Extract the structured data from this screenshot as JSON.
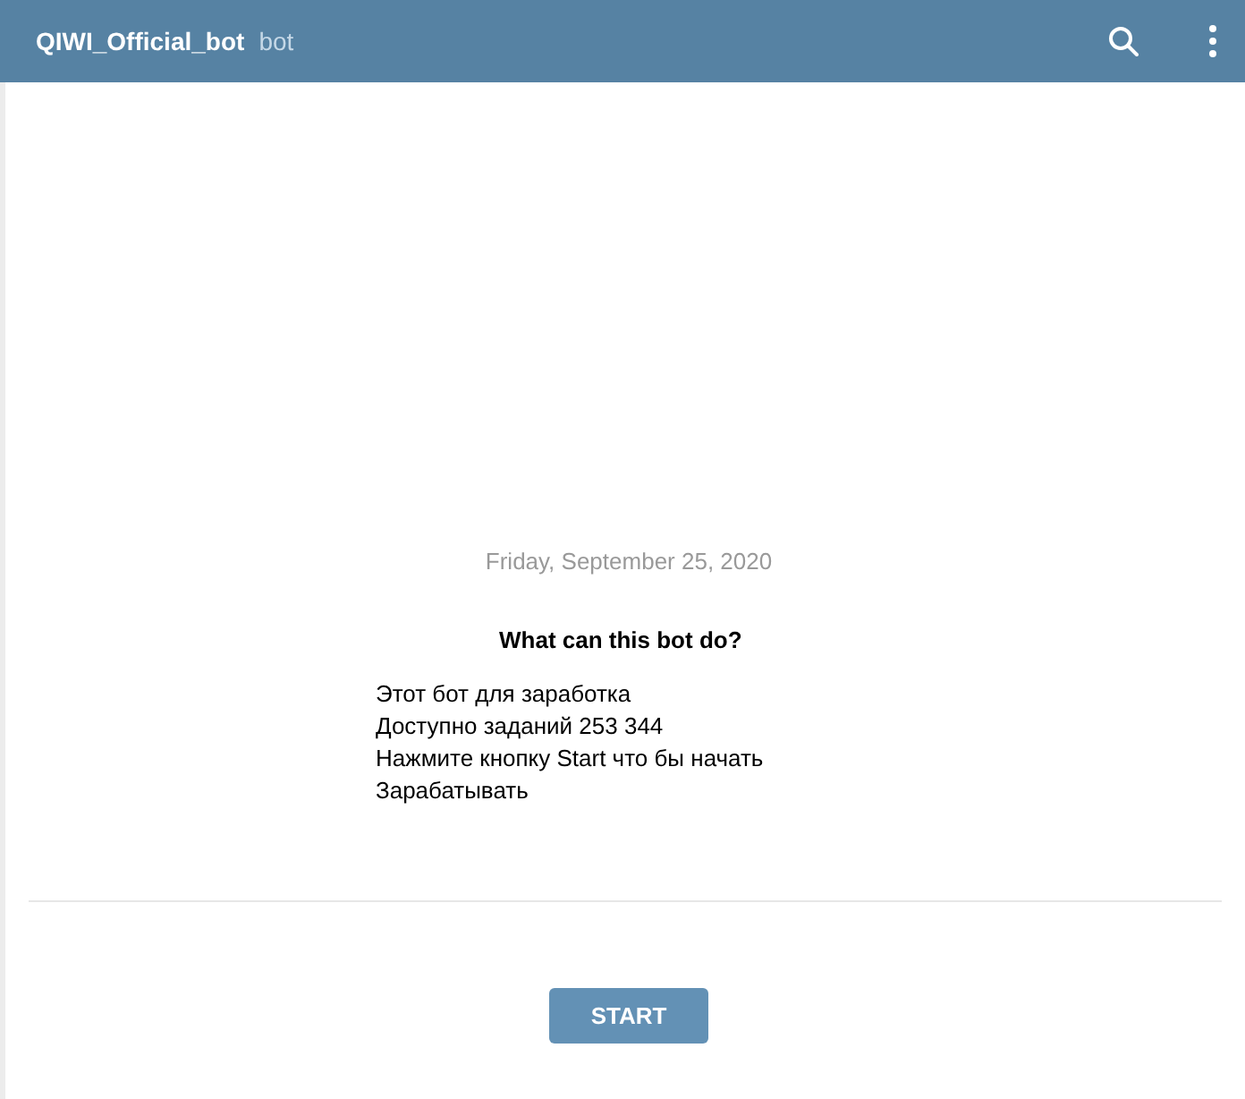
{
  "header": {
    "title": "QIWI_Official_bot",
    "subtitle": "bot"
  },
  "date": "Friday, September 25, 2020",
  "bot_info": {
    "title": "What can this bot do?",
    "lines": [
      "Этот бот для заработка",
      "Доступно заданий 253 344",
      "Нажмите кнопку Start что бы начать",
      "Зарабатывать"
    ]
  },
  "start_button": "START"
}
